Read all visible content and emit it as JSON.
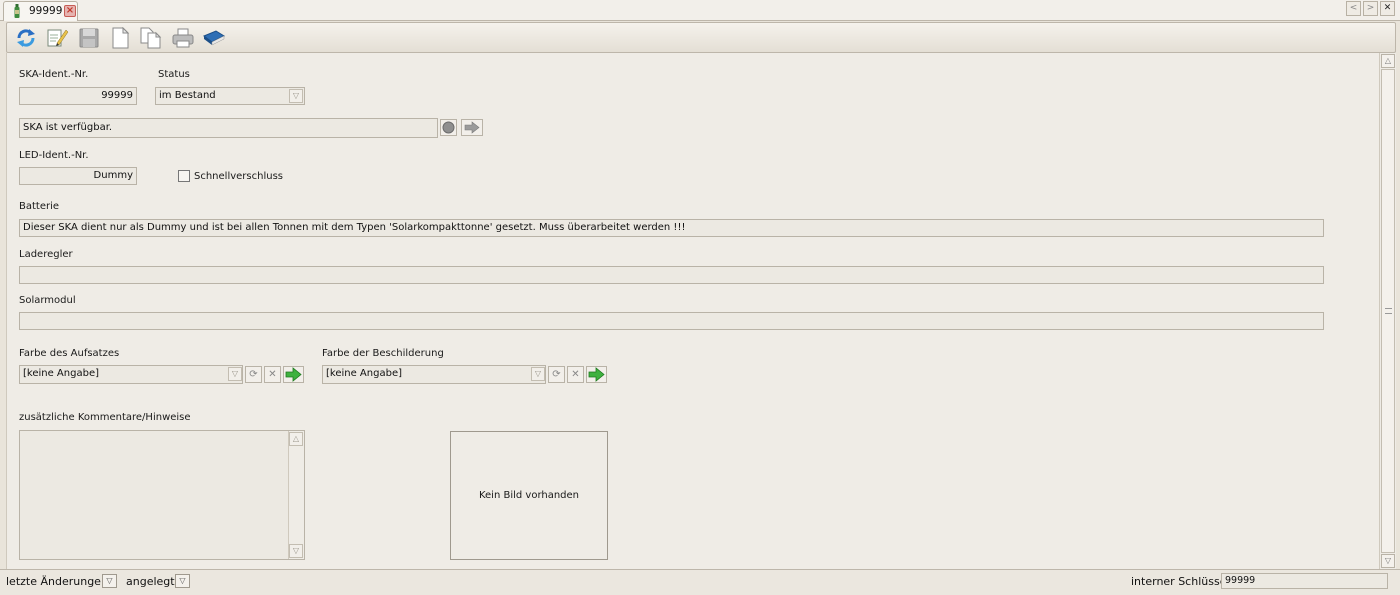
{
  "tab": {
    "label": "99999",
    "close": "×"
  },
  "window": {
    "nav_prev": "<",
    "nav_next": ">",
    "close": "✕"
  },
  "toolbar": {
    "buttons": [
      {
        "icon": "refresh-icon"
      },
      {
        "icon": "edit-icon"
      },
      {
        "icon": "save-icon"
      },
      {
        "icon": "new-document-icon"
      },
      {
        "icon": "copy-document-icon"
      },
      {
        "icon": "print-icon"
      },
      {
        "icon": "book-icon"
      }
    ]
  },
  "form": {
    "ska_ident": {
      "label": "SKA-Ident.-Nr.",
      "value": "99999"
    },
    "status": {
      "label": "Status",
      "value": "im Bestand"
    },
    "availability": {
      "value": "SKA ist verfügbar."
    },
    "led_ident": {
      "label": "LED-Ident.-Nr.",
      "value": "Dummy"
    },
    "schnellverschluss": {
      "label": "Schnellverschluss",
      "checked": false
    },
    "batterie": {
      "label": "Batterie",
      "value": "Dieser SKA dient nur als Dummy und ist bei allen Tonnen mit dem Typen 'Solarkompakttonne' gesetzt. Muss überarbeitet werden !!!"
    },
    "laderegler": {
      "label": "Laderegler",
      "value": ""
    },
    "solarmodul": {
      "label": "Solarmodul",
      "value": ""
    },
    "farbe_aufsatz": {
      "label": "Farbe des Aufsatzes",
      "value": "[keine Angabe]"
    },
    "farbe_beschilderung": {
      "label": "Farbe der Beschilderung",
      "value": "[keine Angabe]"
    },
    "kommentare": {
      "label": "zusätzliche Kommentare/Hinweise",
      "value": ""
    },
    "image": {
      "placeholder": "Kein Bild vorhanden"
    }
  },
  "bottombar": {
    "letzte_aenderungen": "letzte Änderungen",
    "angelegt": "angelegt",
    "interner_schluessel_label": "interner Schlüssel",
    "interner_schluessel_value": "99999"
  },
  "colors": {
    "accent_green": "#2e9a2e",
    "field_bg": "#ece9e2",
    "panel_bg": "#efece6"
  }
}
